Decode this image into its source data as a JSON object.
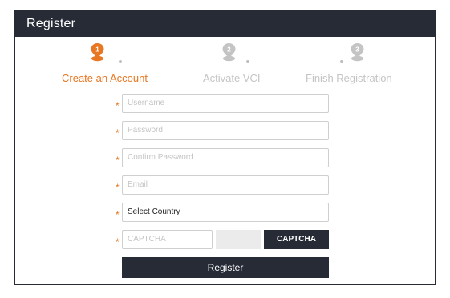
{
  "window": {
    "title": "Register"
  },
  "stepper": {
    "steps": [
      {
        "number": "1",
        "label": "Create an Account",
        "state": "active"
      },
      {
        "number": "2",
        "label": "Activate VCI",
        "state": "inactive"
      },
      {
        "number": "3",
        "label": "Finish Registration",
        "state": "inactive"
      }
    ]
  },
  "form": {
    "required_marker": "*",
    "username": {
      "placeholder": "Username",
      "value": ""
    },
    "password": {
      "placeholder": "Password",
      "value": ""
    },
    "confirm_password": {
      "placeholder": "Confirm Password",
      "value": ""
    },
    "email": {
      "placeholder": "Email",
      "value": ""
    },
    "country": {
      "selected": "Select Country"
    },
    "captcha": {
      "placeholder": "CAPTCHA",
      "value": "",
      "button_label": "CAPTCHA"
    },
    "submit_label": "Register"
  },
  "colors": {
    "accent": "#e87722",
    "dark": "#262b36",
    "inactive": "#c4c4c4"
  }
}
